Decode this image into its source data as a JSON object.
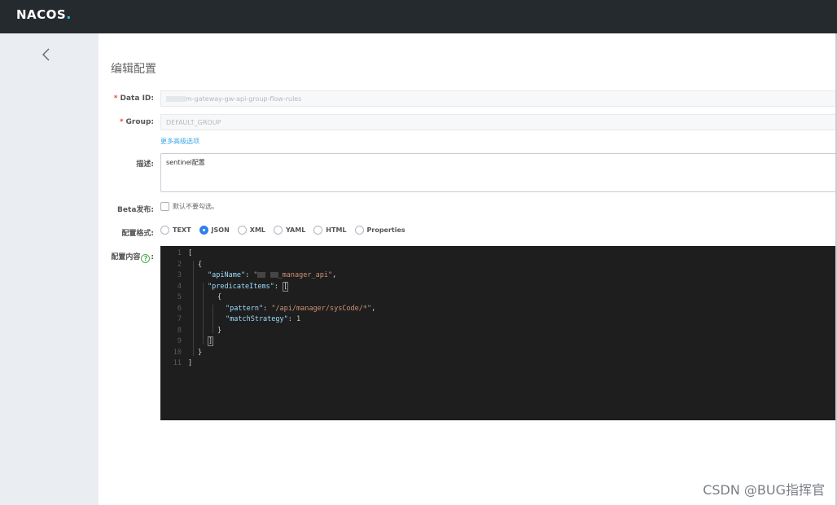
{
  "brand": {
    "logo_text": "NACOS",
    "logo_dot": "."
  },
  "page": {
    "title": "编辑配置"
  },
  "form": {
    "data_id": {
      "label": "Data ID:",
      "value": "m-gateway-gw-api-group-flow-rules"
    },
    "group": {
      "label": "Group:",
      "value": "DEFAULT_GROUP"
    },
    "more_options": "更多高级选项",
    "description": {
      "label": "描述:",
      "value": "sentinel配置"
    },
    "beta": {
      "label": "Beta发布:",
      "checkbox_text": "默认不要勾选。"
    },
    "format": {
      "label": "配置格式:",
      "options": [
        "TEXT",
        "JSON",
        "XML",
        "YAML",
        "HTML",
        "Properties"
      ],
      "selected": "JSON"
    },
    "content": {
      "label": "配置内容",
      "label_suffix": ":"
    }
  },
  "editor": {
    "line_numbers": [
      "1",
      "2",
      "3",
      "4",
      "5",
      "6",
      "7",
      "8",
      "9",
      "10",
      "11"
    ],
    "tokens": {
      "open_bracket": "[",
      "open_brace": "{",
      "apiName_key": "\"apiName\"",
      "colon": ": ",
      "apiName_val_prefix": "\"",
      "apiName_val_suffix": "_manager_api\"",
      "comma": ",",
      "predicate_key": "\"predicateItems\"",
      "inner_open_bracket": "[",
      "inner_open_brace": "{",
      "pattern_key": "\"pattern\"",
      "pattern_val": "\"/api/manager/sysCode/*\"",
      "match_key": "\"matchStrategy\"",
      "match_val": "1",
      "inner_close_brace": "}",
      "inner_close_bracket": "]",
      "close_brace": "}",
      "close_bracket": "]"
    }
  },
  "watermark": "CSDN @BUG指挥官",
  "icons": {
    "back": "chevron-left-icon",
    "help": "question-circle-icon"
  },
  "colors": {
    "topbar": "#252a2f",
    "sidebar": "#eaedf1",
    "accent": "#2f7ff0",
    "editor_bg": "#1e1e1e"
  }
}
